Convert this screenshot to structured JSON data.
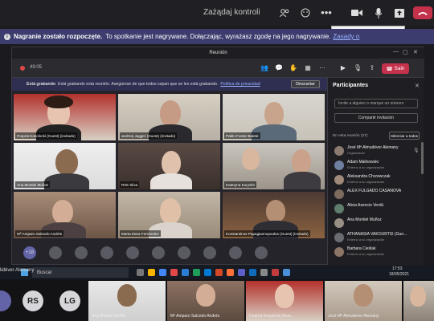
{
  "top_toolbar": {
    "take_control": "Zażądaj kontroli",
    "icons": [
      "participants-icon",
      "reactions-icon",
      "more-icon",
      "camera-icon",
      "mic-icon",
      "share-icon",
      "hangup-icon"
    ]
  },
  "tooltip": "Wycisz (⌘+Shift+M)",
  "recording_banner": {
    "bold": "Nagranie zostało rozpoczęte.",
    "text": "To spotkanie jest nagrywane. Dołączając, wyrażasz zgodę na jego nagrywanie.",
    "link": "Zasady o"
  },
  "inner_window": {
    "title": "Reunión",
    "time": "49:05",
    "leave_label": "Salir",
    "rec_note": {
      "bold": "Está grabando",
      "text": "Está grabando esta reunión. Asegúrese de que todos sepan que se les está grabando.",
      "link": "Política de privacidad",
      "dismiss": "Descartar"
    }
  },
  "video_tiles": [
    {
      "name": "Георгiя Kosolocki (Guest) (invitado)"
    },
    {
      "name": "andrzej Jagger (Guest) (invitado)"
    },
    {
      "name": "Pablo Fuster Batete"
    },
    {
      "name": "Ana Montiel Muñoz"
    },
    {
      "name": "RIIS Silva"
    },
    {
      "name": "Kateryna Kuryshv"
    },
    {
      "name": "Mª Amparo Salcedo Andrés"
    },
    {
      "name": "Marta Mora Fernández"
    },
    {
      "name": "Konstantinos Papagiannopoulos (Guest) (invitado)"
    }
  ],
  "overflow_count": "+18",
  "participants_panel": {
    "title": "Participantes",
    "invite_placeholder": "Invite a alguien o marque un número",
    "share_invite": "Compartir invitación",
    "section": "En esta reunión (27)",
    "mute_all": "Silenciar a todos",
    "people": [
      {
        "name": "José Mª Almudéver Alemany",
        "role": "Organizador"
      },
      {
        "name": "Adam Malinowski",
        "role": "Externo a su organización"
      },
      {
        "name": "Aleksandra Chrzewczak",
        "role": "Externo a su organización"
      },
      {
        "name": "ALEX FULGADO CASANOVA",
        "role": ""
      },
      {
        "name": "Alicia Asencio Verdú",
        "role": ""
      },
      {
        "name": "Ana Montiel Muñoz",
        "role": ""
      },
      {
        "name": "ATHANASIA VAKOURTSI (Gue...",
        "role": "Externo a su organización"
      },
      {
        "name": "Barbara Cieślak",
        "role": "Externo a su organización"
      }
    ]
  },
  "taskbar": {
    "search_label": "Buscar",
    "time": "17:53",
    "date": "18/05/2021"
  },
  "left_name": "lidéver Alemany",
  "bottom_strip": {
    "initials": [
      "RS",
      "LG"
    ],
    "tiles": [
      {
        "name": "Ana Montiel Muñoz"
      },
      {
        "name": "Mª Amparo Salcedo Andrés"
      },
      {
        "name": "Георгiя Kosolocki (Gue..."
      },
      {
        "name": "José Mª Almudéver Alemany"
      }
    ]
  },
  "colors": {
    "accent": "#6264a7",
    "hangup": "#c4314b",
    "banner": "#3c3c6e"
  }
}
